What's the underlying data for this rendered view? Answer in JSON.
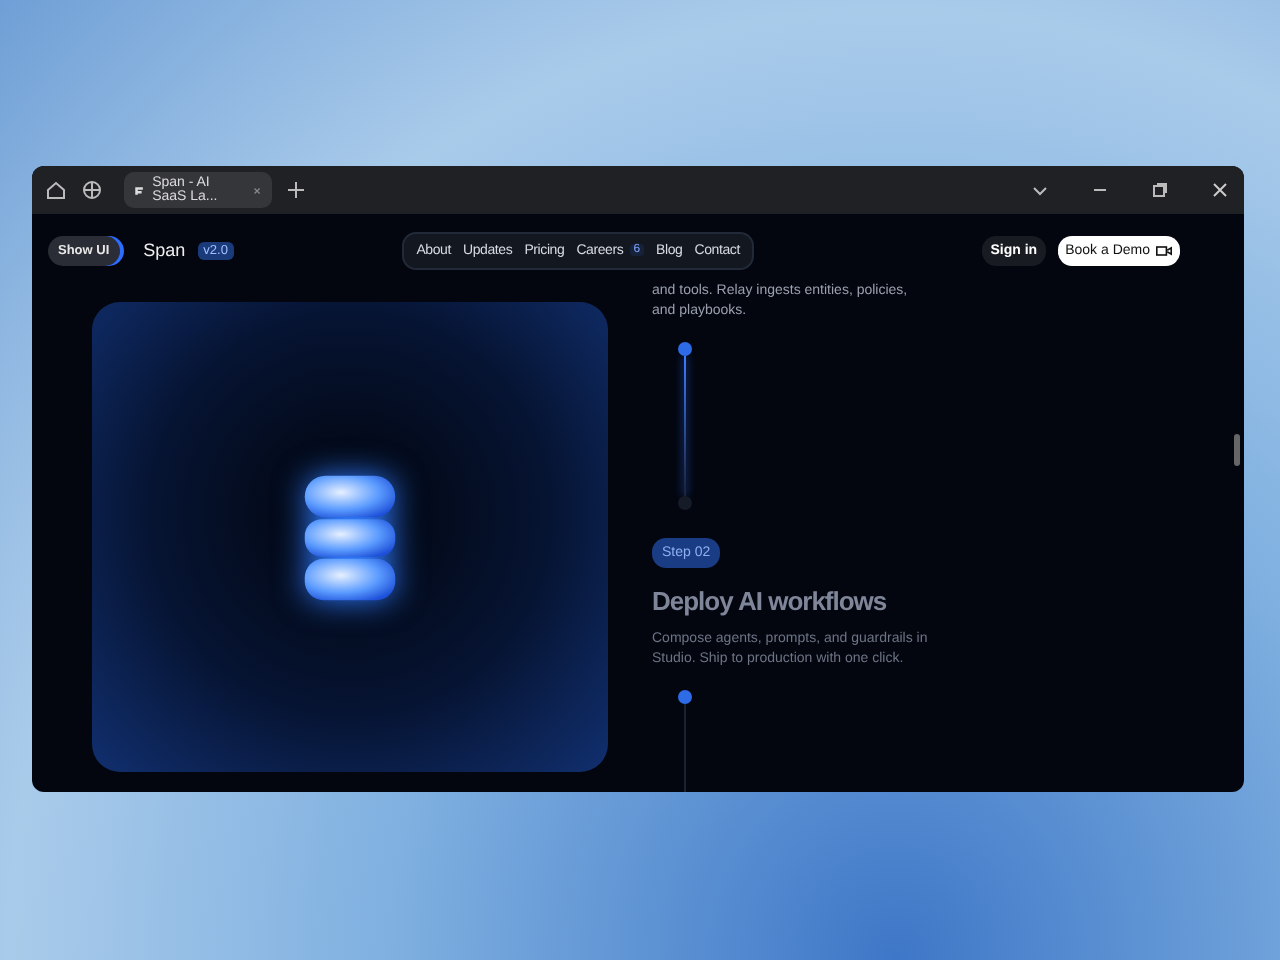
{
  "browser": {
    "tab_title": "Span - AI SaaS La...",
    "tab_selected": true
  },
  "header": {
    "show_ui": "Show UI",
    "brand": "Span",
    "version": "v2.0",
    "nav": [
      {
        "label": "About"
      },
      {
        "label": "Updates"
      },
      {
        "label": "Pricing"
      },
      {
        "label": "Careers",
        "badge": "6"
      },
      {
        "label": "Blog"
      },
      {
        "label": "Contact"
      }
    ],
    "sign_in": "Sign in",
    "book_demo": "Book a Demo"
  },
  "steps": [
    {
      "kind": "partial",
      "description": "and tools. Relay ingests entities, policies, and playbooks."
    },
    {
      "kind": "full",
      "badge": "Step 02",
      "title": "Deploy AI workflows",
      "description": "Compose agents, prompts, and guardrails in Studio. Ship to production with one click."
    }
  ]
}
